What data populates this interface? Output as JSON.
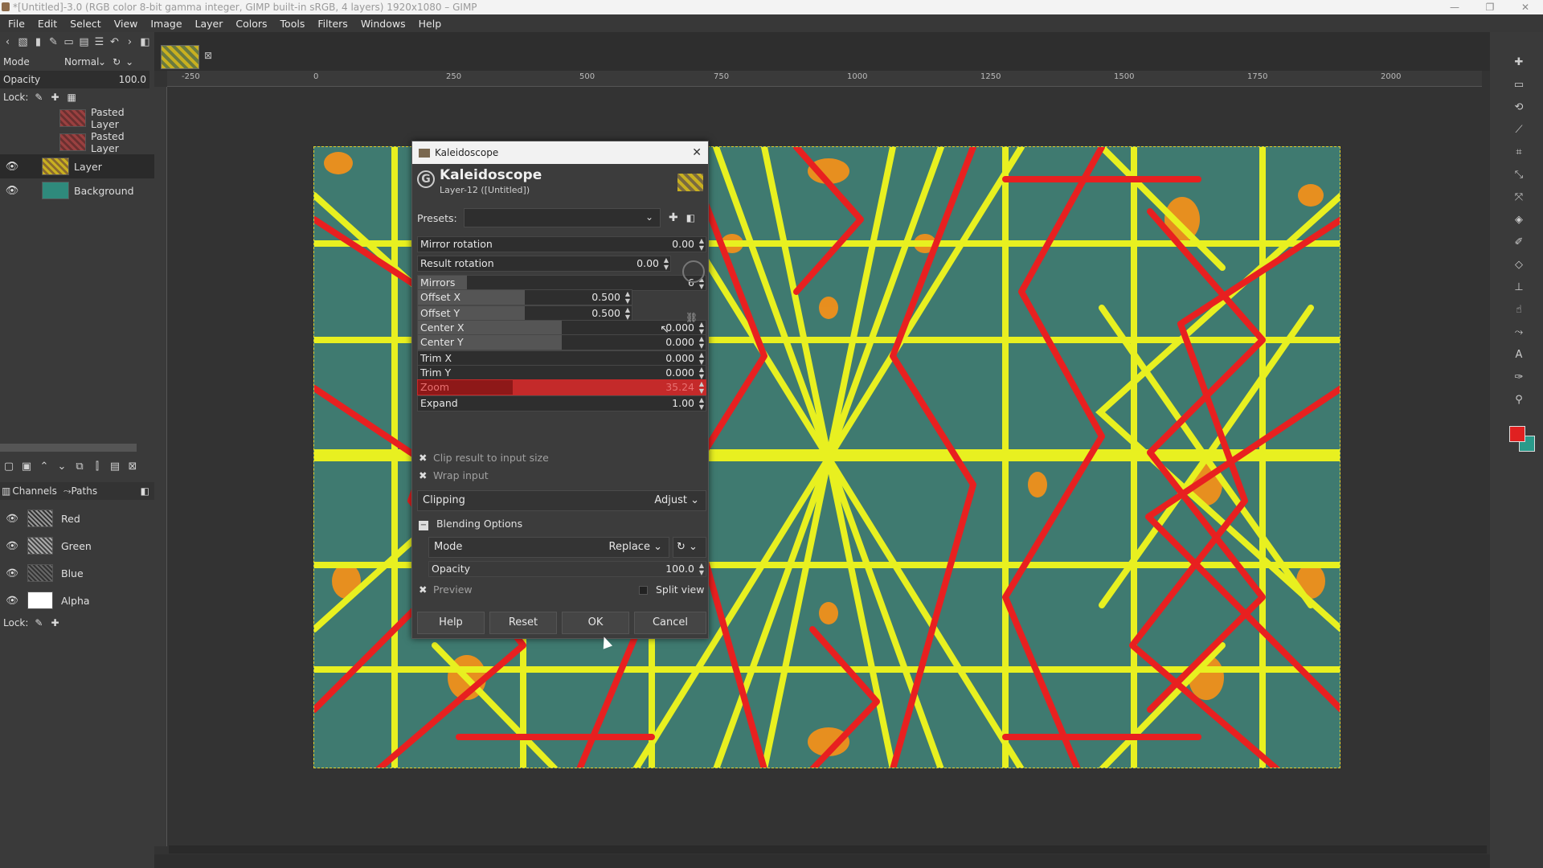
{
  "window": {
    "title": "*[Untitled]-3.0 (RGB color 8-bit gamma integer, GIMP built-in sRGB, 4 layers) 1920x1080 – GIMP",
    "controls": [
      "—",
      "❐",
      "✕"
    ]
  },
  "menu": [
    "File",
    "Edit",
    "Select",
    "View",
    "Image",
    "Layer",
    "Colors",
    "Tools",
    "Filters",
    "Windows",
    "Help"
  ],
  "layers_panel": {
    "mode_label": "Mode",
    "mode_value": "Normal",
    "opacity_label": "Opacity",
    "opacity_value": "100.0",
    "lock_label": "Lock:",
    "layers": [
      {
        "name": "Pasted Layer",
        "visible": false
      },
      {
        "name": "Pasted Layer",
        "visible": false
      },
      {
        "name": "Layer",
        "visible": true,
        "selected": true
      },
      {
        "name": "Background",
        "visible": true
      }
    ]
  },
  "channels_panel": {
    "tabs": [
      "Channels",
      "Paths"
    ],
    "channels": [
      "Red",
      "Green",
      "Blue",
      "Alpha"
    ],
    "lock_label": "Lock:"
  },
  "ruler": [
    "-250",
    "0",
    "250",
    "500",
    "750",
    "1000",
    "1250",
    "1500",
    "1750",
    "2000"
  ],
  "dialog": {
    "window_title": "Kaleidoscope",
    "name": "Kaleidoscope",
    "subtitle": "Layer-12 ([Untitled])",
    "presets_label": "Presets:",
    "sliders": [
      {
        "label": "Mirror rotation",
        "value": "0.00",
        "fill": 0.0
      },
      {
        "label": "Result rotation",
        "value": "0.00",
        "fill": 0.0
      },
      {
        "label": "Mirrors",
        "value": "6",
        "fill": 0.17
      },
      {
        "label": "Offset X",
        "value": "0.500",
        "fill": 0.5
      },
      {
        "label": "Offset Y",
        "value": "0.500",
        "fill": 0.5
      },
      {
        "label": "Center X",
        "value": "0.000",
        "fill": 0.5
      },
      {
        "label": "Center Y",
        "value": "0.000",
        "fill": 0.5
      },
      {
        "label": "Trim X",
        "value": "0.000",
        "fill": 0.0
      },
      {
        "label": "Trim Y",
        "value": "0.000",
        "fill": 0.0
      },
      {
        "label": "Zoom",
        "value": "35.24",
        "fill": 0.33
      },
      {
        "label": "Expand",
        "value": "1.00",
        "fill": 0.0
      }
    ],
    "clip_result": "Clip result to input size",
    "wrap_input": "Wrap input",
    "clipping_label": "Clipping",
    "clipping_value": "Adjust",
    "blending_label": "Blending Options",
    "mode_label": "Mode",
    "mode_value": "Replace",
    "opacity_label": "Opacity",
    "opacity_value": "100.0",
    "preview_label": "Preview",
    "split_view_label": "Split view",
    "buttons": {
      "help": "Help",
      "reset": "Reset",
      "ok": "OK",
      "cancel": "Cancel"
    }
  },
  "colors": {
    "fg": "#e02020",
    "bg": "#2a9a8a",
    "pattern_bg": "#3f7a70",
    "pattern_yellow": "#e8f020",
    "pattern_red": "#e82020",
    "pattern_orange": "#f0901a"
  }
}
